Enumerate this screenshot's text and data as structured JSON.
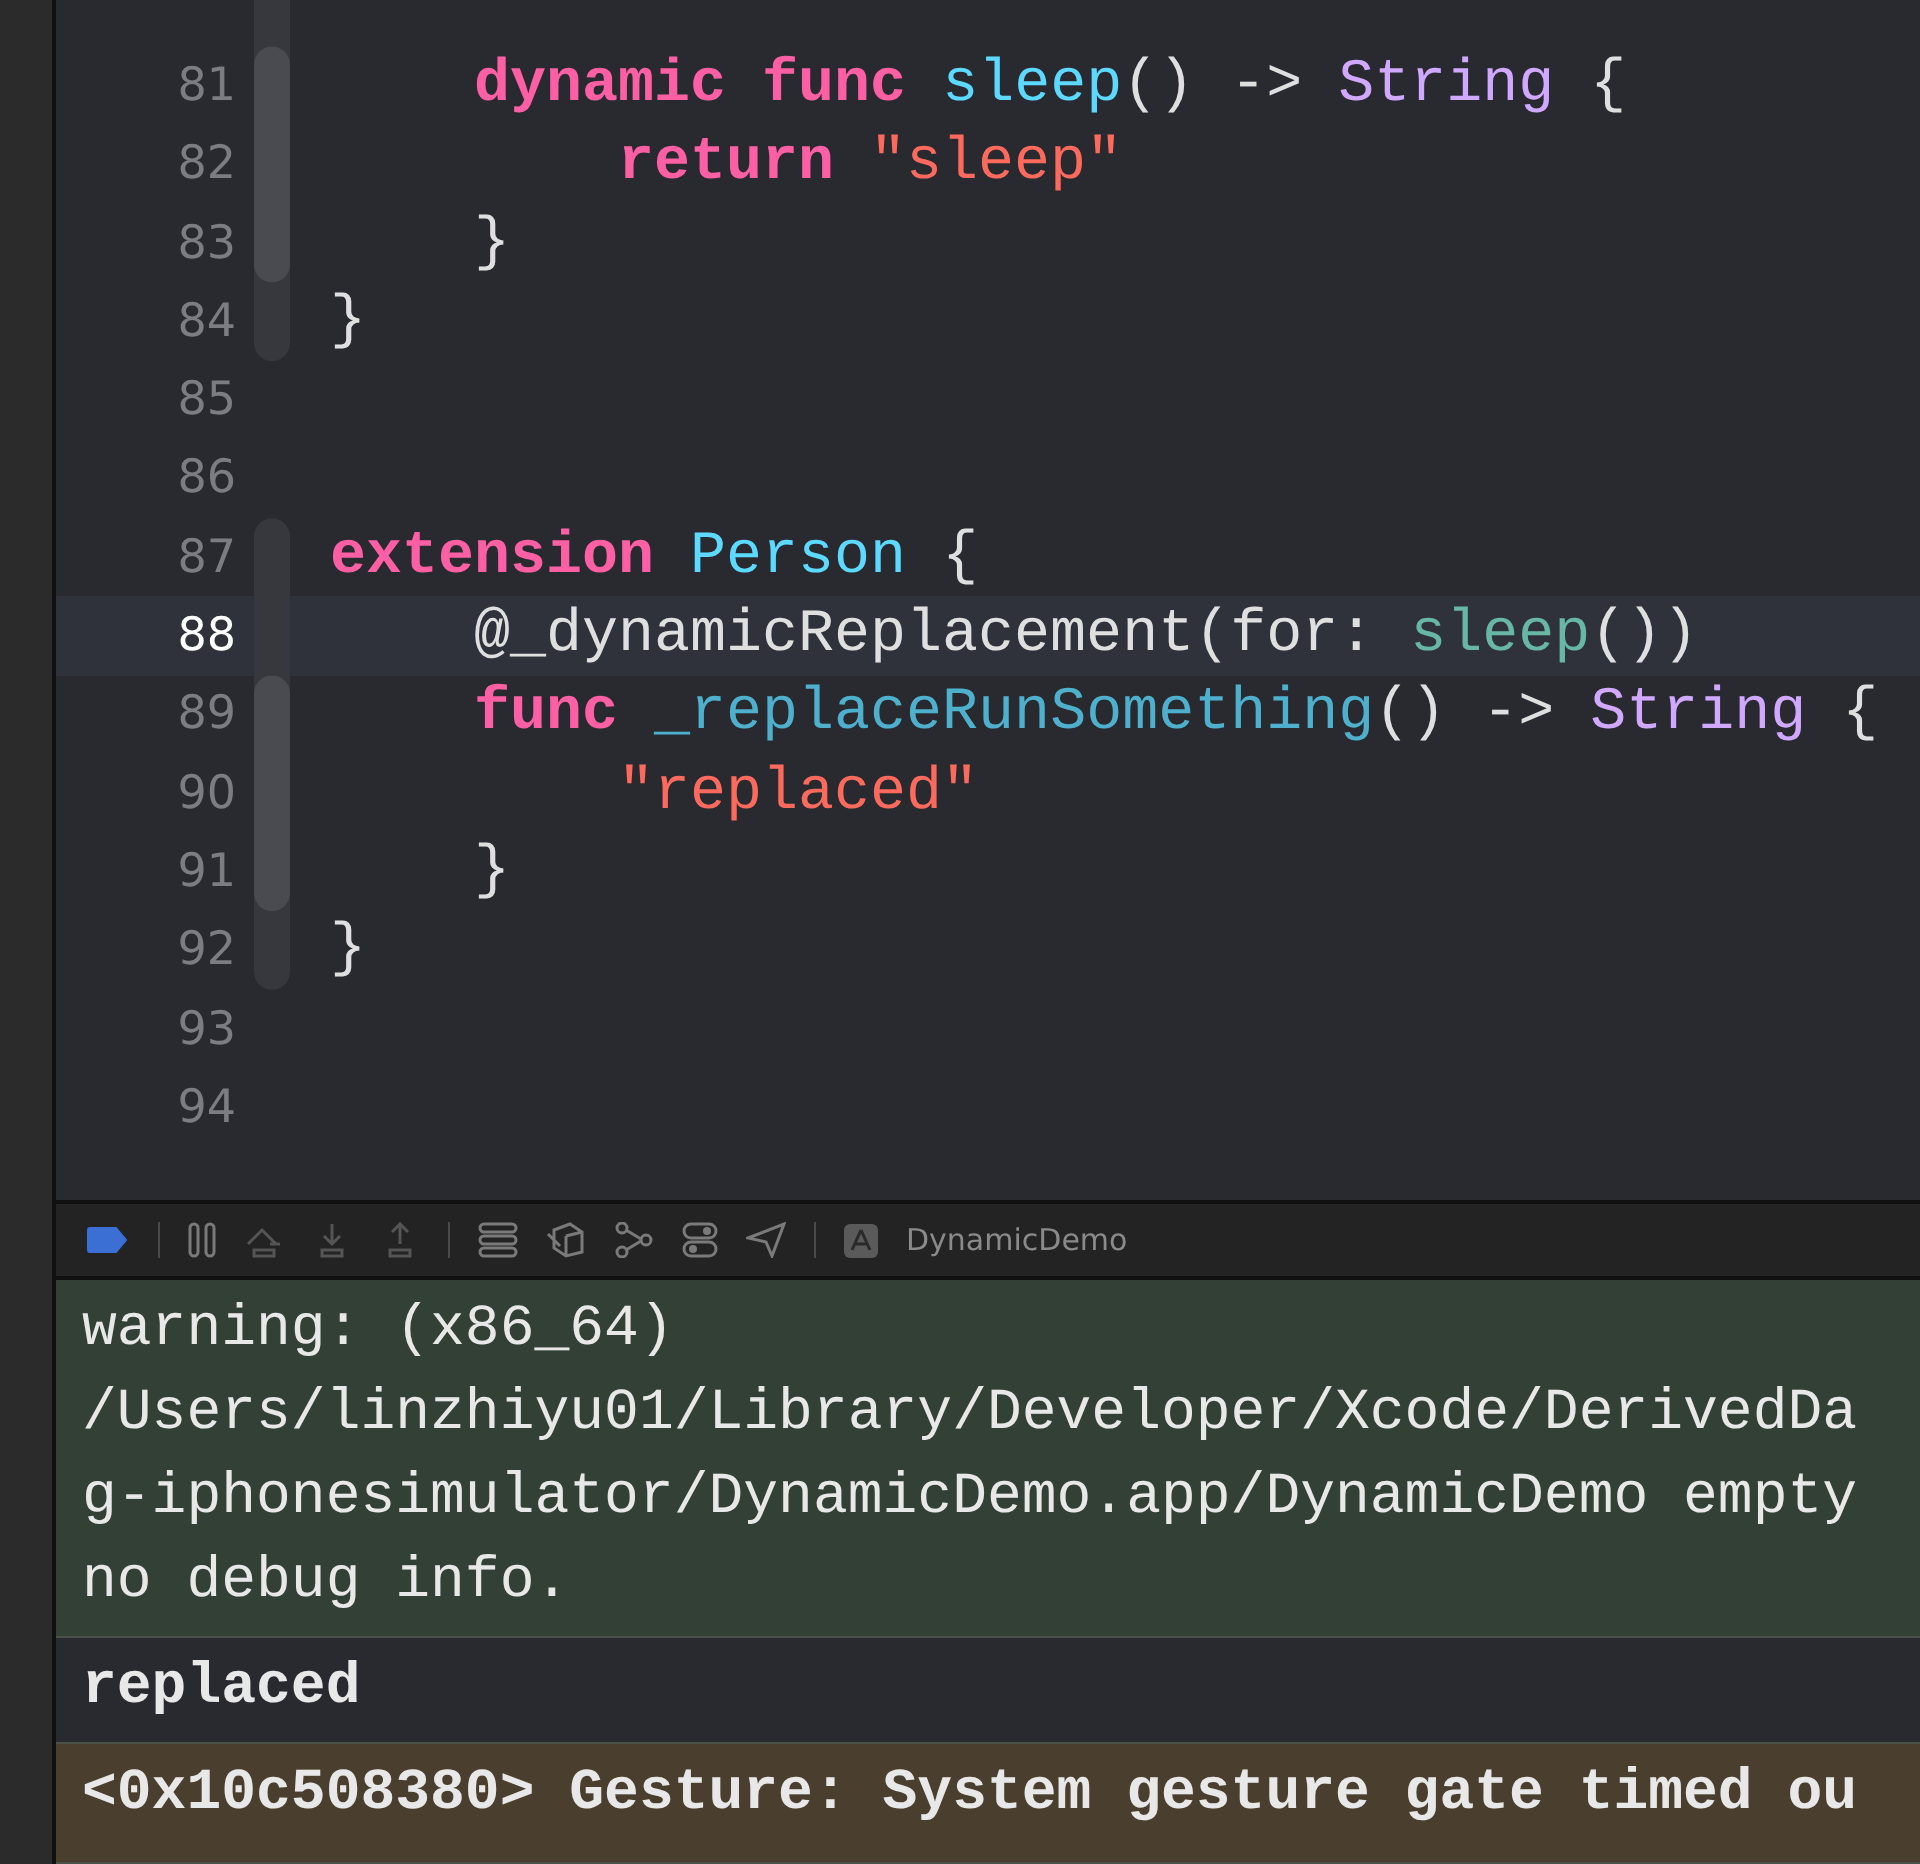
{
  "editor": {
    "lines": [
      {
        "number": "81",
        "current": false,
        "tokens": [
          {
            "kind": "keyword",
            "text": "    dynamic func "
          },
          {
            "kind": "decl",
            "text": "sleep"
          },
          {
            "kind": "plain",
            "text": "() -> "
          },
          {
            "kind": "type",
            "text": "String"
          },
          {
            "kind": "plain",
            "text": " {"
          }
        ]
      },
      {
        "number": "82",
        "current": false,
        "tokens": [
          {
            "kind": "keyword",
            "text": "        return "
          },
          {
            "kind": "string",
            "text": "\"sleep\""
          }
        ]
      },
      {
        "number": "83",
        "current": false,
        "tokens": [
          {
            "kind": "plain",
            "text": "    }"
          }
        ]
      },
      {
        "number": "84",
        "current": false,
        "tokens": [
          {
            "kind": "plain",
            "text": "}"
          }
        ]
      },
      {
        "number": "85",
        "current": false
      },
      {
        "number": "86",
        "current": false
      },
      {
        "number": "87",
        "current": false,
        "tokens": [
          {
            "kind": "keyword",
            "text": "extension "
          },
          {
            "kind": "typedecl",
            "text": "Person"
          },
          {
            "kind": "plain",
            "text": " {"
          }
        ]
      },
      {
        "number": "88",
        "current": true,
        "tokens": [
          {
            "kind": "plain",
            "text": "    @_dynamicReplacement(for: "
          },
          {
            "kind": "call",
            "text": "sleep"
          },
          {
            "kind": "plain",
            "text": "())"
          }
        ]
      },
      {
        "number": "89",
        "current": false,
        "tokens": [
          {
            "kind": "keyword",
            "text": "    func "
          },
          {
            "kind": "decl2",
            "text": "_replaceRunSomething"
          },
          {
            "kind": "plain",
            "text": "() -> "
          },
          {
            "kind": "type",
            "text": "String"
          },
          {
            "kind": "plain",
            "text": " {"
          }
        ]
      },
      {
        "number": "90",
        "current": false,
        "tokens": [
          {
            "kind": "string",
            "text": "        \"replaced\""
          }
        ]
      },
      {
        "number": "91",
        "current": false,
        "tokens": [
          {
            "kind": "plain",
            "text": "    }"
          }
        ]
      },
      {
        "number": "92",
        "current": false,
        "tokens": [
          {
            "kind": "plain",
            "text": "}"
          }
        ]
      },
      {
        "number": "93",
        "current": false
      },
      {
        "number": "94",
        "current": false
      }
    ]
  },
  "debug_bar": {
    "breakpoints_active": true,
    "target": "DynamicDemo"
  },
  "console": {
    "messages": [
      {
        "kind": "warning",
        "lines": [
          "warning: (x86_64)",
          "/Users/linzhiyu01/Library/Developer/Xcode/DerivedDa",
          "g-iphonesimulator/DynamicDemo.app/DynamicDemo empty",
          "no debug info."
        ]
      },
      {
        "kind": "output",
        "lines": [
          "replaced"
        ]
      },
      {
        "kind": "log",
        "lines": [
          "<0x10c508380> Gesture: System gesture gate timed ou"
        ]
      }
    ]
  }
}
